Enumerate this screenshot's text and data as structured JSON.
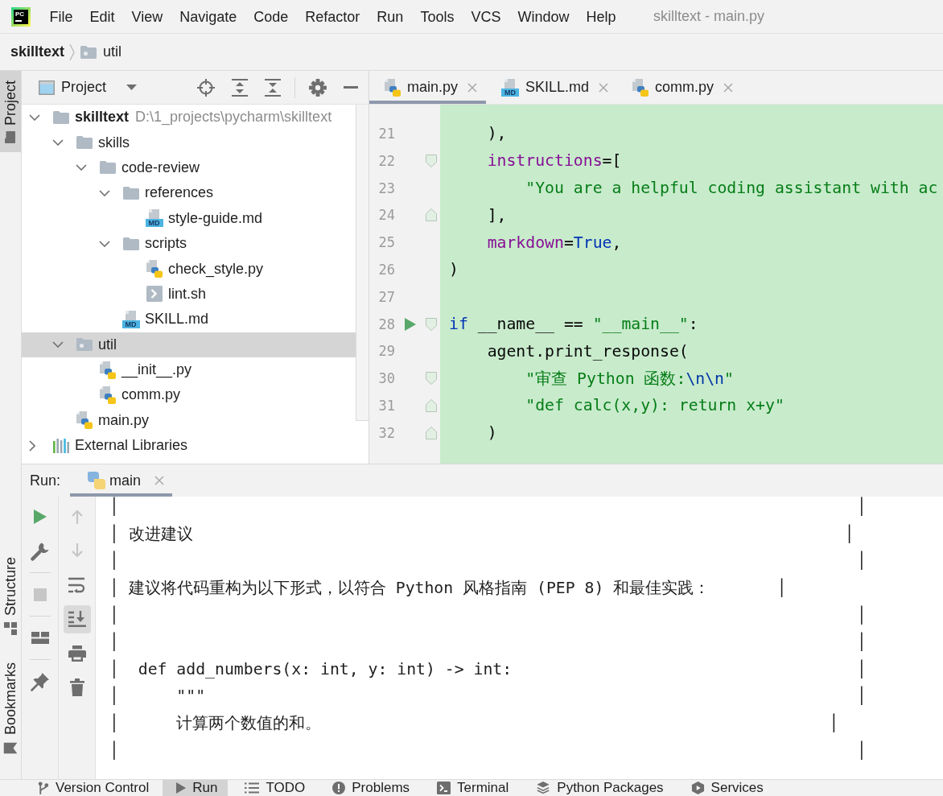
{
  "menu_bar": {
    "logo": "PC",
    "items": [
      "File",
      "Edit",
      "View",
      "Navigate",
      "Code",
      "Refactor",
      "Run",
      "Tools",
      "VCS",
      "Window",
      "Help"
    ],
    "window_title": "skilltext - main.py"
  },
  "breadcrumb": [
    {
      "label": "skilltext",
      "kind": "project"
    },
    {
      "label": "util",
      "kind": "module"
    }
  ],
  "left_stripe": {
    "top": [
      {
        "label": "Project",
        "kind": "project",
        "selected": true
      }
    ],
    "bottom": [
      {
        "label": "Structure",
        "kind": "structure",
        "selected": false
      },
      {
        "label": "Bookmarks",
        "kind": "bookmarks",
        "selected": false
      }
    ]
  },
  "project_panel": {
    "title": "Project",
    "tools": [
      [
        {
          "kind": "locate"
        },
        {
          "kind": "expand"
        },
        {
          "kind": "collapse"
        }
      ],
      [
        {
          "kind": "gear"
        },
        {
          "kind": "hide"
        }
      ]
    ],
    "tree": [
      {
        "label": "skilltext",
        "kind": "root",
        "path": "D:\\1_projects\\pycharm\\skilltext",
        "expanded": true,
        "selected": false,
        "children": [
          {
            "label": "skills",
            "kind": "folder",
            "expanded": true,
            "selected": false,
            "children": [
              {
                "label": "code-review",
                "kind": "folder",
                "expanded": true,
                "selected": false,
                "children": [
                  {
                    "label": "references",
                    "kind": "folder",
                    "expanded": true,
                    "selected": false,
                    "children": [
                      {
                        "label": "style-guide.md",
                        "kind": "md",
                        "badge": "MD",
                        "selected": false
                      }
                    ]
                  },
                  {
                    "label": "scripts",
                    "kind": "folder",
                    "expanded": true,
                    "selected": false,
                    "children": [
                      {
                        "label": "check_style.py",
                        "kind": "py",
                        "selected": false
                      },
                      {
                        "label": "lint.sh",
                        "kind": "sh",
                        "selected": false
                      }
                    ]
                  },
                  {
                    "label": "SKILL.md",
                    "kind": "md",
                    "badge": "MD",
                    "selected": false
                  }
                ]
              }
            ]
          },
          {
            "label": "util",
            "kind": "module",
            "expanded": true,
            "selected": true,
            "children": [
              {
                "label": "__init__.py",
                "kind": "py",
                "selected": false
              },
              {
                "label": "comm.py",
                "kind": "py",
                "selected": false
              }
            ]
          },
          {
            "label": "main.py",
            "kind": "py",
            "selected": false
          }
        ]
      },
      {
        "label": "External Libraries",
        "kind": "libs",
        "expanded": false,
        "selected": false
      }
    ]
  },
  "editor": {
    "tabs": [
      {
        "label": "main.py",
        "kind": "py",
        "selected": true
      },
      {
        "label": "SKILL.md",
        "kind": "md",
        "badge": "MD",
        "selected": false
      },
      {
        "label": "comm.py",
        "kind": "py",
        "selected": false
      }
    ],
    "lines": [
      {
        "number": "21",
        "tokens": [
          {
            "text": "    ),",
            "kind": "plain"
          }
        ],
        "fold_start": false,
        "fold_end": false,
        "run": false
      },
      {
        "number": "22",
        "tokens": [
          {
            "text": "    instructions",
            "kind": "param"
          },
          {
            "text": "=[",
            "kind": "plain"
          }
        ],
        "fold_start": true,
        "fold_end": false,
        "run": false
      },
      {
        "number": "23",
        "tokens": [
          {
            "text": "        \"You are a helpful coding assistant with ac",
            "kind": "string"
          }
        ],
        "fold_start": false,
        "fold_end": false,
        "run": false
      },
      {
        "number": "24",
        "tokens": [
          {
            "text": "    ],",
            "kind": "plain"
          }
        ],
        "fold_start": false,
        "fold_end": true,
        "run": false
      },
      {
        "number": "25",
        "tokens": [
          {
            "text": "    markdown",
            "kind": "param"
          },
          {
            "text": "=",
            "kind": "plain"
          },
          {
            "text": "True",
            "kind": "keyword"
          },
          {
            "text": ",",
            "kind": "plain"
          }
        ],
        "fold_start": false,
        "fold_end": false,
        "run": false
      },
      {
        "number": "26",
        "tokens": [
          {
            "text": ")",
            "kind": "plain"
          }
        ],
        "fold_start": false,
        "fold_end": false,
        "run": false
      },
      {
        "number": "27",
        "fold_start": false,
        "fold_end": false,
        "run": false
      },
      {
        "number": "28",
        "tokens": [
          {
            "text": "if",
            "kind": "keyword"
          },
          {
            "text": " __name__ == ",
            "kind": "plain"
          },
          {
            "text": "\"__main__\"",
            "kind": "string"
          },
          {
            "text": ":",
            "kind": "plain"
          }
        ],
        "fold_start": true,
        "fold_end": false,
        "run": true
      },
      {
        "number": "29",
        "tokens": [
          {
            "text": "    agent.print_response(",
            "kind": "plain"
          }
        ],
        "fold_start": false,
        "fold_end": false,
        "run": false
      },
      {
        "number": "30",
        "tokens": [
          {
            "text": "        \"审查 Python 函数:",
            "kind": "string"
          },
          {
            "text": "\\n\\n",
            "kind": "escape"
          },
          {
            "text": "\"",
            "kind": "string"
          }
        ],
        "fold_start": true,
        "fold_end": false,
        "run": false
      },
      {
        "number": "31",
        "tokens": [
          {
            "text": "        \"def calc(x,y): return x+y\"",
            "kind": "string"
          }
        ],
        "fold_start": false,
        "fold_end": true,
        "run": false
      },
      {
        "number": "32",
        "tokens": [
          {
            "text": "    )",
            "kind": "plain"
          }
        ],
        "fold_start": false,
        "fold_end": true,
        "run": false
      }
    ]
  },
  "run_panel": {
    "label": "Run:",
    "tabs": [
      {
        "label": "main",
        "selected": true
      }
    ],
    "toolbar": [
      [
        {
          "kind": "run",
          "disabled": false
        },
        {
          "kind": "wrench",
          "disabled": false
        }
      ],
      [
        {
          "kind": "stop",
          "disabled": true
        }
      ],
      [
        {
          "kind": "layout",
          "disabled": false
        }
      ],
      [
        {
          "kind": "pin",
          "disabled": false
        }
      ]
    ],
    "toolbar_2": [
      {
        "kind": "up",
        "disabled": true,
        "on": false
      },
      {
        "kind": "down",
        "disabled": true,
        "on": false
      },
      {
        "kind": "wrap",
        "disabled": false,
        "on": false
      },
      {
        "kind": "scroll",
        "disabled": false,
        "on": true
      },
      {
        "kind": "print",
        "disabled": false,
        "on": false
      },
      {
        "kind": "trash",
        "disabled": false,
        "on": false
      }
    ],
    "console": [
      {
        "text": "│",
        "edge": "│"
      },
      {
        "text": "│ 改进建议",
        "edge": "│"
      },
      {
        "text": "│",
        "edge": "│"
      },
      {
        "text": "│ 建议将代码重构为以下形式，以符合 Python 风格指南 (PEP 8) 和最佳实践：",
        "edge": "│"
      },
      {
        "text": "│",
        "edge": "│"
      },
      {
        "text": "│",
        "edge": "│"
      },
      {
        "text": "│  def add_numbers(x: int, y: int) -> int:",
        "edge": "│"
      },
      {
        "text": "│      \"\"\"",
        "edge": "│"
      },
      {
        "text": "│      计算两个数值的和。",
        "edge": "│"
      },
      {
        "text": "│",
        "edge": "│"
      }
    ]
  },
  "tool_window_bar": [
    {
      "label": "Version Control",
      "kind": "vcs",
      "selected": false
    },
    {
      "label": "Run",
      "kind": "run",
      "selected": true
    },
    {
      "label": "TODO",
      "kind": "todo",
      "selected": false
    },
    {
      "label": "Problems",
      "kind": "problems",
      "selected": false
    },
    {
      "label": "Terminal",
      "kind": "terminal",
      "selected": false
    },
    {
      "label": "Python Packages",
      "kind": "packages",
      "selected": false
    },
    {
      "label": "Services",
      "kind": "services",
      "selected": false
    }
  ]
}
